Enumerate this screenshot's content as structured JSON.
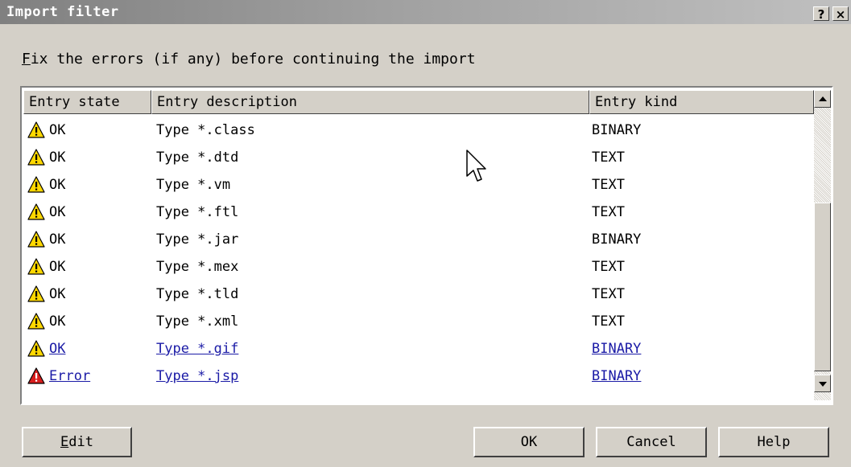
{
  "window": {
    "title": "Import filter",
    "help_glyph": "?",
    "close_glyph": "×"
  },
  "instruction": {
    "accel": "F",
    "rest": "ix the errors (if any) before continuing the import"
  },
  "columns": {
    "state": "Entry state",
    "description": "Entry description",
    "kind": "Entry kind"
  },
  "entries": [
    {
      "state": "OK",
      "description": "Type *.class",
      "kind": "BINARY",
      "icon": "warning-icon",
      "link": false
    },
    {
      "state": "OK",
      "description": "Type *.dtd",
      "kind": "TEXT",
      "icon": "warning-icon",
      "link": false
    },
    {
      "state": "OK",
      "description": "Type *.vm",
      "kind": "TEXT",
      "icon": "warning-icon",
      "link": false
    },
    {
      "state": "OK",
      "description": "Type *.ftl",
      "kind": "TEXT",
      "icon": "warning-icon",
      "link": false
    },
    {
      "state": "OK",
      "description": "Type *.jar",
      "kind": "BINARY",
      "icon": "warning-icon",
      "link": false
    },
    {
      "state": "OK",
      "description": "Type *.mex",
      "kind": "TEXT",
      "icon": "warning-icon",
      "link": false
    },
    {
      "state": "OK",
      "description": "Type *.tld",
      "kind": "TEXT",
      "icon": "warning-icon",
      "link": false
    },
    {
      "state": "OK",
      "description": "Type *.xml",
      "kind": "TEXT",
      "icon": "warning-icon",
      "link": false
    },
    {
      "state": "OK",
      "description": "Type *.gif",
      "kind": "BINARY",
      "icon": "warning-icon",
      "link": true
    },
    {
      "state": "Error",
      "description": "Type *.jsp",
      "kind": "BINARY",
      "icon": "error-icon",
      "link": true
    }
  ],
  "buttons": {
    "edit_accel": "E",
    "edit_rest": "dit",
    "ok": "OK",
    "cancel": "Cancel",
    "help": "Help"
  },
  "colors": {
    "dialog_bg": "#d4d0c8",
    "link": "#1a1aa6",
    "warning": "#ffd800",
    "error": "#d81e1e"
  }
}
